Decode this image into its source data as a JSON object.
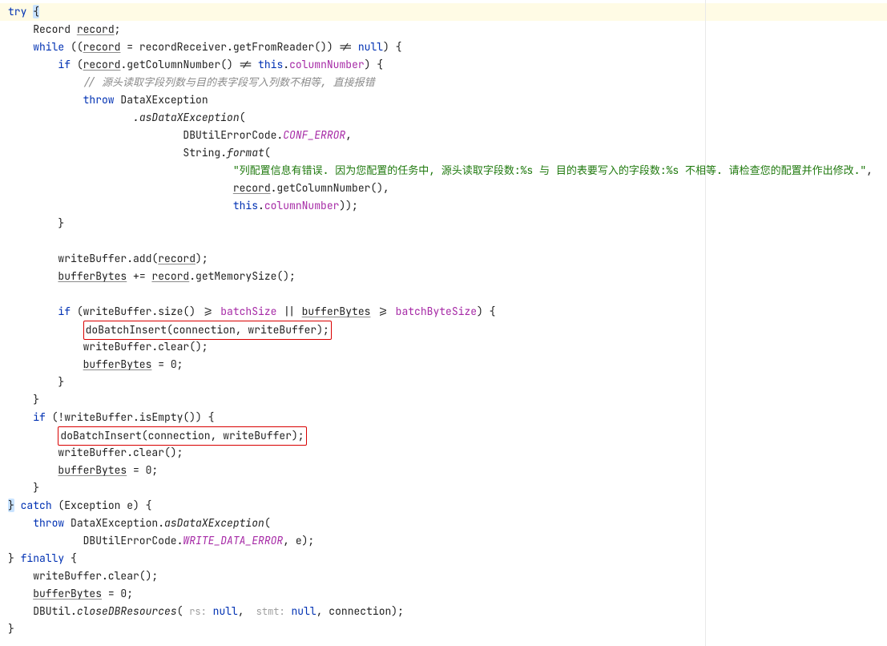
{
  "l1": {
    "try": "try",
    "opn": "{"
  },
  "l2": {
    "t": "Record ",
    "u": "record",
    "t2": ";"
  },
  "l3": {
    "kw": "while",
    "t1": " ((",
    "u": "record",
    "t2": " = recordReceiver.getFromReader()) != ",
    "nul": "null",
    "t3": ") {"
  },
  "l4": {
    "kw": "if",
    "t1": " (",
    "u": "record",
    "t2": ".getColumnNumber() != ",
    "th": "this",
    "d": ".",
    "fld": "columnNumber",
    "t3": ") {"
  },
  "l5": {
    "cm": "// 源头读取字段列数与目的表字段写入列数不相等, 直接报错"
  },
  "l6": {
    "kw": "throw",
    "t": " DataXException"
  },
  "l7": {
    "m": ".asDataXException",
    "t": "("
  },
  "l8": {
    "t1": "DBUtilErrorCode.",
    "c": "CONF_ERROR",
    "t2": ","
  },
  "l9": {
    "t1": "String.",
    "m": "format",
    "t2": "("
  },
  "l10": {
    "s": "\"列配置信息有错误. 因为您配置的任务中, 源头读取字段数:%s 与 目的表要写入的字段数:%s 不相等. 请检查您的配置并作出修改.\"",
    "t": ","
  },
  "l11": {
    "u": "record",
    "t": ".getColumnNumber(),"
  },
  "l12": {
    "th": "this",
    "d": ".",
    "f": "columnNumber",
    "t": "));"
  },
  "l13": {
    "t": "}"
  },
  "l14": {
    "": ""
  },
  "l15": {
    "t1": "writeBuffer.add(",
    "u": "record",
    "t2": ");"
  },
  "l16": {
    "u1": "bufferBytes",
    "t1": " += ",
    "u2": "record",
    "t2": ".getMemorySize();"
  },
  "l17": {
    "": ""
  },
  "l18": {
    "kw": "if",
    "t1": " (writeBuffer.size() >= ",
    "f1": "batchSize",
    "t2": " || ",
    "u": "bufferBytes",
    "t3": " >= ",
    "f2": "batchByteSize",
    "t4": ") {"
  },
  "l19": {
    "t": "doBatchInsert(connection, writeBuffer);"
  },
  "l20": {
    "t": "writeBuffer.clear();"
  },
  "l21": {
    "u": "bufferBytes",
    "t": " = 0;"
  },
  "l22": {
    "t": "}"
  },
  "l23": {
    "t": "}"
  },
  "l24": {
    "kw": "if",
    "t": " (!writeBuffer.isEmpty()) {"
  },
  "l25": {
    "t": "doBatchInsert(connection, writeBuffer);"
  },
  "l26": {
    "t": "writeBuffer.clear();"
  },
  "l27": {
    "u": "bufferBytes",
    "t": " = 0;"
  },
  "l28": {
    "t": "}"
  },
  "l29": {
    "cb": "}",
    "ca": " catch",
    "t": " (Exception e) {"
  },
  "l30": {
    "kw": "throw",
    "t1": " DataXException.",
    "m": "asDataXException",
    "t2": "("
  },
  "l31": {
    "t1": "DBUtilErrorCode.",
    "c": "WRITE_DATA_ERROR",
    "t2": ", e);"
  },
  "l32": {
    "cb": "}",
    "fn": " finally",
    "ob": " {"
  },
  "l33": {
    "t": "writeBuffer.clear();"
  },
  "l34": {
    "u": "bufferBytes",
    "t": " = 0;"
  },
  "l35": {
    "t1": "DBUtil.",
    "m": "closeDBResources",
    "t2": "( ",
    "h1": "rs:",
    "n1": " null",
    "t3": ", ",
    "h2": " stmt:",
    "n2": " null",
    "t4": ", connection);"
  },
  "l36": {
    "t": "}"
  }
}
